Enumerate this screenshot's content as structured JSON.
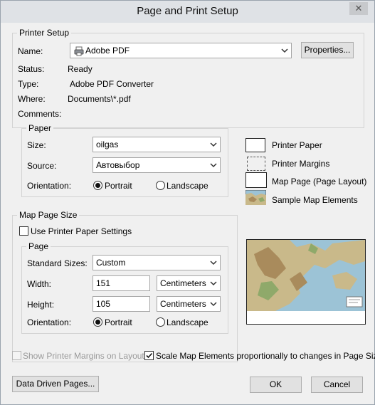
{
  "window": {
    "title": "Page and Print Setup",
    "close_glyph": "✕"
  },
  "printer_setup": {
    "title": "Printer Setup",
    "name_label": "Name:",
    "name_value": "Adobe PDF",
    "properties_button": "Properties...",
    "status_label": "Status:",
    "status_value": "Ready",
    "type_label": "Type:",
    "type_value": "Adobe PDF Converter",
    "where_label": "Where:",
    "where_value": "Documents\\*.pdf",
    "comments_label": "Comments:",
    "paper": {
      "title": "Paper",
      "size_label": "Size:",
      "size_value": "oilgas",
      "source_label": "Source:",
      "source_value": "Автовыбор",
      "orientation_label": "Orientation:",
      "portrait_label": "Portrait",
      "landscape_label": "Landscape",
      "orientation_selected": "Portrait"
    }
  },
  "legend": {
    "printer_paper": "Printer Paper",
    "printer_margins": "Printer Margins",
    "map_page": "Map Page (Page Layout)",
    "sample_map": "Sample Map Elements"
  },
  "map_page_size": {
    "title": "Map Page Size",
    "use_printer_paper": "Use Printer Paper Settings",
    "use_printer_paper_checked": false,
    "page": {
      "title": "Page",
      "standard_sizes_label": "Standard Sizes:",
      "standard_sizes_value": "Custom",
      "width_label": "Width:",
      "width_value": "151",
      "width_unit": "Centimeters",
      "height_label": "Height:",
      "height_value": "105",
      "height_unit": "Centimeters",
      "orientation_label": "Orientation:",
      "portrait_label": "Portrait",
      "landscape_label": "Landscape",
      "orientation_selected": "Portrait"
    }
  },
  "options": {
    "show_margins": "Show Printer Margins on Layout",
    "show_margins_checked": false,
    "show_margins_enabled": false,
    "scale_elements": "Scale Map Elements proportionally to changes in Page Size",
    "scale_elements_checked": true
  },
  "buttons": {
    "data_driven": "Data Driven Pages...",
    "ok": "OK",
    "cancel": "Cancel"
  },
  "colors": {
    "window_bg": "#f0f0f0",
    "titlebar_bg": "#dfe2e6",
    "map_sea": "#9cc3d6",
    "map_land": "#c9b98a",
    "map_mountain": "#a98b5c"
  },
  "icons": {
    "printer": "printer-icon",
    "dropdown": "chevron-down-icon",
    "close": "close-icon"
  }
}
